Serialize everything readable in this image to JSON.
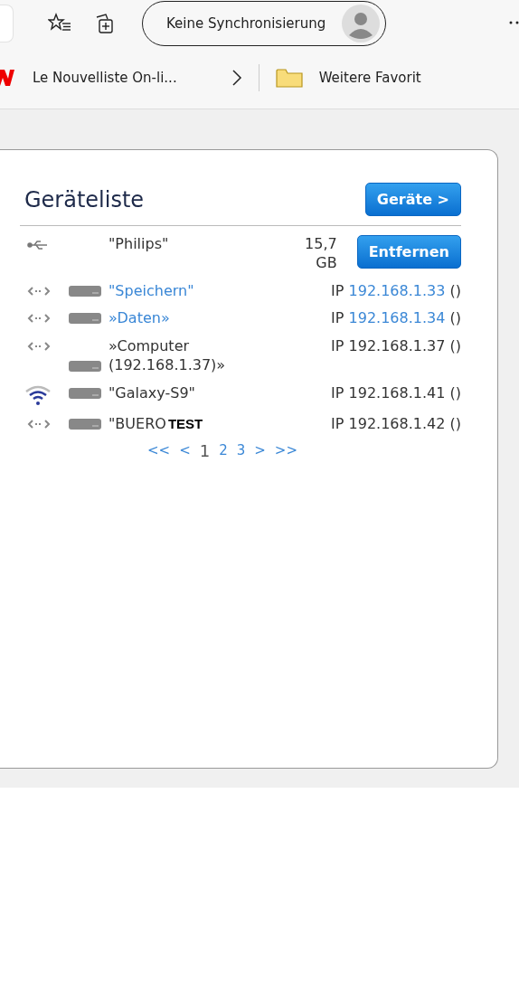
{
  "toolbar": {
    "sync_button": "Keine Synchronisierung"
  },
  "bookmarks": [
    {
      "label": "Le Nouvelliste On-li...",
      "kind": "site"
    },
    {
      "label": "Weitere Favorit",
      "kind": "folder"
    }
  ],
  "panel": {
    "title": "Geräteliste",
    "button": "Geräte >",
    "devices": [
      {
        "kind": "usb",
        "name": "\"Philips\"",
        "name_link": false,
        "size": "15,7 GB",
        "action": "Entfernen"
      },
      {
        "kind": "lan",
        "name": "\"Speichern\"",
        "name_link": true,
        "ip_prefix": "IP",
        "ip": "192.168.1.33",
        "ip_link": true,
        "suffix": "()"
      },
      {
        "kind": "lan",
        "name": "»Daten»",
        "name_link": true,
        "ip_prefix": "IP",
        "ip": "192.168.1.34",
        "ip_link": true,
        "suffix": "()"
      },
      {
        "kind": "lan",
        "name": "»Computer (192.168.1.37)»",
        "name_link": false,
        "ip_prefix": "IP",
        "ip": "192.168.1.37",
        "ip_link": false,
        "suffix": "()"
      },
      {
        "kind": "wifi",
        "name": "\"Galaxy-S9\"",
        "name_link": false,
        "ip_prefix": "IP",
        "ip": "192.168.1.41",
        "ip_link": false,
        "suffix": "()"
      },
      {
        "kind": "lan",
        "name": "\"BUERO",
        "name_link": false,
        "overlay": "TEST",
        "ip_prefix": "IP",
        "ip": "192.168.1.42",
        "ip_link": false,
        "suffix": "()"
      }
    ],
    "pagination": [
      {
        "label": "<<",
        "selected": false
      },
      {
        "label": "<",
        "selected": false
      },
      {
        "label": "1",
        "selected": true
      },
      {
        "label": "2",
        "selected": false
      },
      {
        "label": "3",
        "selected": false
      },
      {
        "label": ">",
        "selected": false
      },
      {
        "label": ">>",
        "selected": false
      }
    ]
  }
}
